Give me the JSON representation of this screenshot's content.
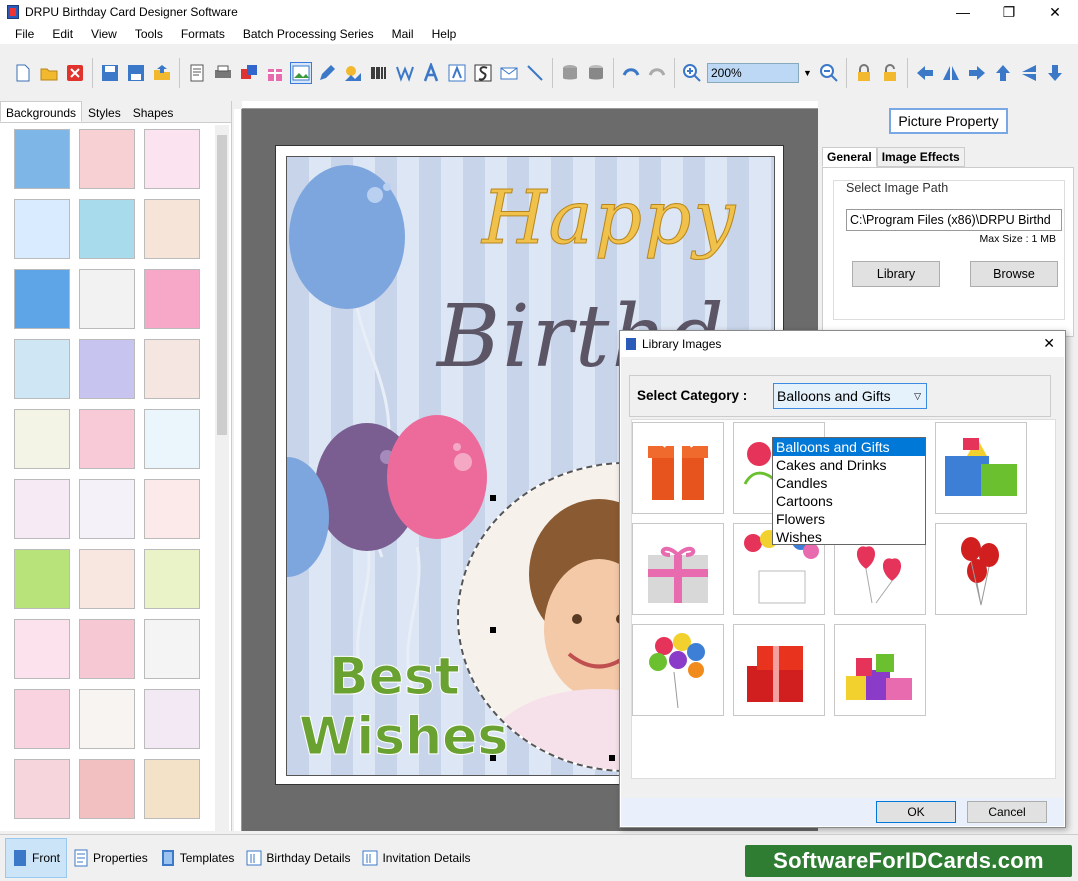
{
  "window": {
    "title": "DRPU Birthday Card Designer Software",
    "controls": [
      "—",
      "❐",
      "✕"
    ]
  },
  "menu": [
    "File",
    "Edit",
    "View",
    "Tools",
    "Formats",
    "Batch Processing Series",
    "Mail",
    "Help"
  ],
  "toolbar": {
    "zoom_value": "200%"
  },
  "left_panel": {
    "tabs": [
      "Backgrounds",
      "Styles",
      "Shapes"
    ],
    "active_tab": "Backgrounds",
    "thumb_colors": [
      "#7fb6e8",
      "#f6d0d2",
      "#fbe3f0",
      "#d9ecff",
      "#a8dcec",
      "#f7e4d8",
      "#5da5e6",
      "#f2f2f2",
      "#f7a8c8",
      "#cfe6f4",
      "#c8c4f0",
      "#f6e6e2",
      "#f3f3e6",
      "#f8cad8",
      "#eaf6fb",
      "#f6eaf4",
      "#f5f1f8",
      "#fceaea",
      "#b8e27a",
      "#f8e6e1",
      "#eaf2c8",
      "#fbe2ec",
      "#f6c8d4",
      "#f4f4f4",
      "#f9d3e0",
      "#f7f4f2",
      "#f2e9f4",
      "#f6d6dc",
      "#f2c0c0",
      "#f4e2c8"
    ]
  },
  "card": {
    "happy": "Happy",
    "birthday": "Birthd",
    "best": "Best",
    "wishes": "Wishes"
  },
  "right_panel": {
    "picture_property": "Picture Property",
    "tabs": [
      "General",
      "Image Effects"
    ],
    "select_image_path": "Select Image Path",
    "path_value": "C:\\Program Files (x86)\\DRPU Birthd",
    "max_size": "Max Size : 1 MB",
    "library_button": "Library",
    "browse_button": "Browse"
  },
  "dialog": {
    "title": "Library Images",
    "close": "✕",
    "select_category_label": "Select Category :",
    "selected_category": "Balloons and Gifts",
    "categories": [
      "Balloons and Gifts",
      "Cakes and Drinks",
      "Candles",
      "Cartoons",
      "Flowers",
      "Wishes"
    ],
    "ok": "OK",
    "cancel": "Cancel"
  },
  "bottom_bar": {
    "items": [
      "Front",
      "Properties",
      "Templates",
      "Birthday Details",
      "Invitation Details"
    ],
    "active": "Front",
    "brand": "SoftwareForIDCards.com"
  }
}
